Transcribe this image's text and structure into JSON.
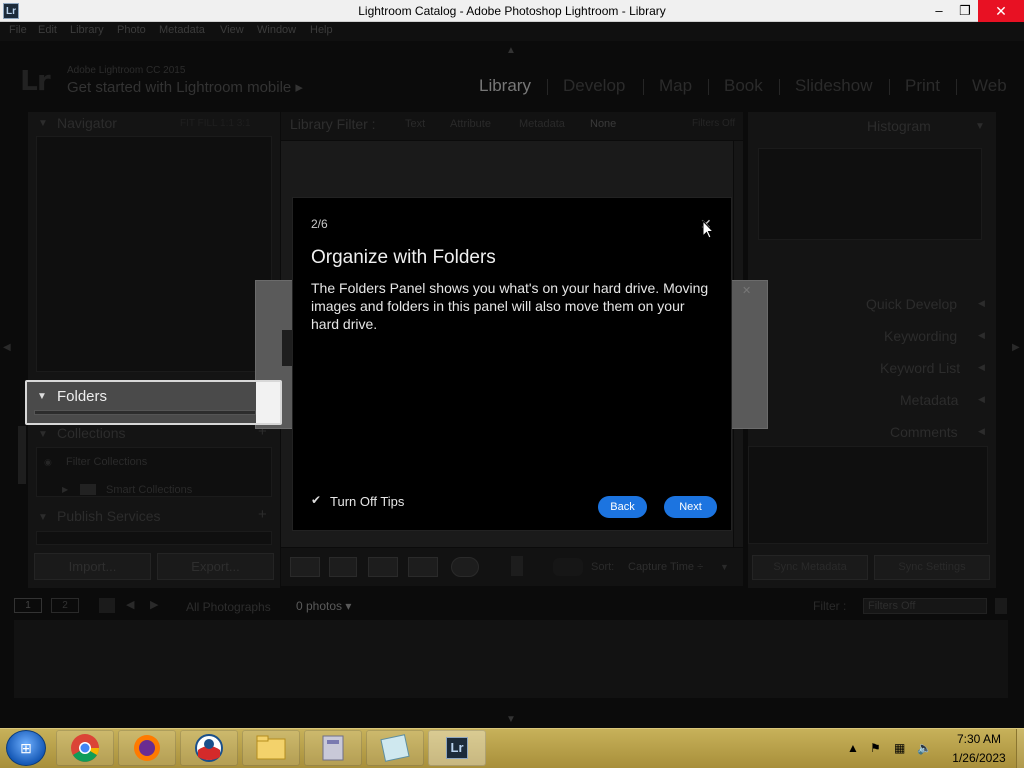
{
  "window": {
    "title": "Lightroom Catalog - Adobe Photoshop Lightroom - Library",
    "app_icon": "Lr",
    "minimize": "–",
    "restore": "❐",
    "close": "✕"
  },
  "menu": [
    "File",
    "Edit",
    "Library",
    "Photo",
    "Metadata",
    "View",
    "Window",
    "Help"
  ],
  "identity": {
    "logo": "Lr",
    "version": "Adobe Lightroom CC 2015",
    "mobile": "Get started with Lightroom mobile ▸"
  },
  "modules": [
    "Library",
    "Develop",
    "Map",
    "Book",
    "Slideshow",
    "Print",
    "Web"
  ],
  "left_panel": {
    "navigator": "Navigator",
    "navigator_options": "FIT FILL 1:1 3:1",
    "folders": "Folders",
    "collections": "Collections",
    "filter_collections": "Filter Collections",
    "smart_collections": "Smart Collections",
    "publish_services": "Publish Services",
    "import": "Import...",
    "export": "Export..."
  },
  "filter_bar": {
    "title": "Library Filter :",
    "options": [
      "Text",
      "Attribute",
      "Metadata",
      "None"
    ],
    "filters_off": "Filters Off"
  },
  "right_panel": {
    "histogram": "Histogram",
    "items": [
      "Quick Develop",
      "Keywording",
      "Keyword List",
      "Metadata",
      "Comments"
    ],
    "sync_metadata": "Sync Metadata",
    "sync_settings": "Sync Settings"
  },
  "tip": {
    "step": "2/6",
    "close": "✕",
    "title": "Organize with Folders",
    "body": "The Folders Panel shows you what's on your hard drive. Moving images and folders in this panel will also move them on your hard drive.",
    "checkbox": "✔",
    "checkbox_label": "Turn Off Tips",
    "back": "Back",
    "next": "Next"
  },
  "toolbar": {
    "sort_label": "Sort:",
    "sort_value": "Capture Time ÷"
  },
  "filmbar": {
    "page1": "1",
    "page2": "2",
    "all_photos": "All Photographs",
    "photo_count": "0 photos ▾",
    "filter_label": "Filter :",
    "filter_value": "Filters Off"
  },
  "taskbar": {
    "time": "7:30 AM",
    "date": "1/26/2023",
    "lr_label": "Lr"
  }
}
